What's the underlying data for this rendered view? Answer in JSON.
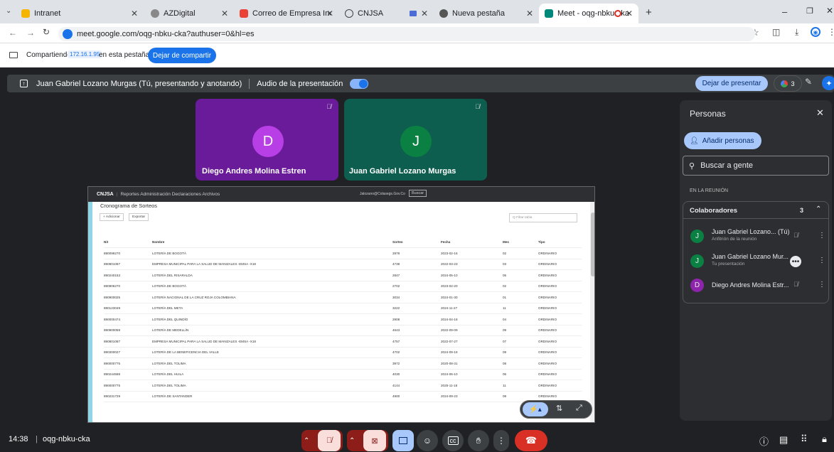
{
  "browser": {
    "tabs": [
      {
        "label": "Intranet",
        "active": false
      },
      {
        "label": "AZDigital",
        "active": false
      },
      {
        "label": "Correo de Empresa Industrial y",
        "active": false
      },
      {
        "label": "CNJSA",
        "active": false
      },
      {
        "label": "Nueva pestaña",
        "active": false
      },
      {
        "label": "Meet - oqg-nbku-cka",
        "active": true
      }
    ],
    "url": "meet.google.com/oqg-nbku-cka?authuser=0&hl=es"
  },
  "sharing": {
    "label": "Compartiendo",
    "ip": "172.16.1.95",
    "suffix": "en esta pestaña",
    "stop_button": "Dejar de compartir"
  },
  "presenter_bar": {
    "presenter": "Juan Gabriel Lozano Murgas (Tú, presentando y anotando)",
    "audio_label": "Audio de la presentación",
    "stop_button": "Dejar de presentar",
    "participant_count": "3"
  },
  "tiles": [
    {
      "initial": "D",
      "name": "Diego Andres Molina Estren",
      "color": "#b83ee5"
    },
    {
      "initial": "J",
      "name": "Juan Gabriel Lozano Murgas",
      "color": "#0b8043"
    }
  ],
  "shared_screen": {
    "nav_brand": "CNJSA",
    "nav_items": "Reportes  Administración  Declaraciones  Archivos",
    "nav_user": "Jalozano@Colasegs.Gov.Co",
    "nav_search": "Buscar",
    "page_title": "Cronograma de Sorteos",
    "add_button": "+ Adicionar",
    "export_button": "Exportar",
    "filter_placeholder": "Q  Filtar tabla",
    "columns": [
      "Nit",
      "Nombre",
      "Sorteo",
      "Fecha",
      "Mes",
      "Tipo"
    ],
    "rows": [
      [
        "890099270",
        "LOTERÍA DE BOGOTÁ",
        "2878",
        "2023-02-16",
        "02",
        "ORDINARIO"
      ],
      [
        "890801087",
        "EMPRESA MUNICIPAL PARA LA SALUD DE MANIZALES -EMSA -X18",
        "4739",
        "2022-03-23",
        "03",
        "ORDINARIO"
      ],
      [
        "890240153",
        "LOTERÍA DEL RISARALDA",
        "2847",
        "2024-05-10",
        "05",
        "ORDINARIO"
      ],
      [
        "890906270",
        "LOTERÍA DE BOGOTÁ",
        "2702",
        "2023-02-20",
        "02",
        "ORDINARIO"
      ],
      [
        "890900025",
        "LOTERÍA NACIONAL DE LA CRUZ ROJA COLOMBIANA",
        "3034",
        "2024-01-30",
        "01",
        "ORDINARIO"
      ],
      [
        "890123049",
        "LOTERÍA DEL META",
        "3222",
        "2024-11-27",
        "11",
        "ORDINARIO"
      ],
      [
        "890000474",
        "LOTERÍA DEL QUINDÍO",
        "2908",
        "2024-04-18",
        "04",
        "ORDINARIO"
      ],
      [
        "890900059",
        "LOTERÍA DE MEDELLÍN",
        "4643",
        "2022-09-09",
        "09",
        "ORDINARIO"
      ],
      [
        "890801087",
        "EMPRESA MUNICIPAL PARA LA SALUD DE MANIZALES -EMSA -X18",
        "4757",
        "2022-07-27",
        "07",
        "ORDINARIO"
      ],
      [
        "890300027",
        "LOTERÍA DE LA BENEFICENCIA DEL VALLE",
        "4702",
        "2024-09-18",
        "09",
        "ORDINARIO"
      ],
      [
        "890000775",
        "LOTERÍA DEL TOLIMA",
        "3972",
        "2020-08-31",
        "08",
        "ORDINARIO"
      ],
      [
        "890244588",
        "LOTERÍA DEL HUILA",
        "4030",
        "2024-06-10",
        "06",
        "ORDINARIO"
      ],
      [
        "890000775",
        "LOTERÍA DEL TOLIMA",
        "4144",
        "2025-11-18",
        "11",
        "ORDINARIO"
      ],
      [
        "890231729",
        "LOTERÍA DE SANTANDER",
        "4900",
        "2024-09-23",
        "09",
        "ORDINARIO"
      ]
    ]
  },
  "people_panel": {
    "title": "Personas",
    "add_button": "Añadir personas",
    "search_placeholder": "Buscar a gente",
    "section": "EN LA REUNIÓN",
    "group_label": "Colaboradores",
    "group_count": "3",
    "people": [
      {
        "initial": "J",
        "name": "Juan Gabriel Lozano... (Tú)",
        "sub": "Anfitrión de la reunión",
        "color": "#0b8043"
      },
      {
        "initial": "J",
        "name": "Juan Gabriel Lozano Mur...",
        "sub": "Tu presentación",
        "color": "#0b8043"
      },
      {
        "initial": "D",
        "name": "Diego Andres Molina Estr...",
        "sub": "",
        "color": "#8e24aa"
      }
    ]
  },
  "bottom": {
    "time": "14:38",
    "meeting_code": "oqg-nbku-cka"
  }
}
